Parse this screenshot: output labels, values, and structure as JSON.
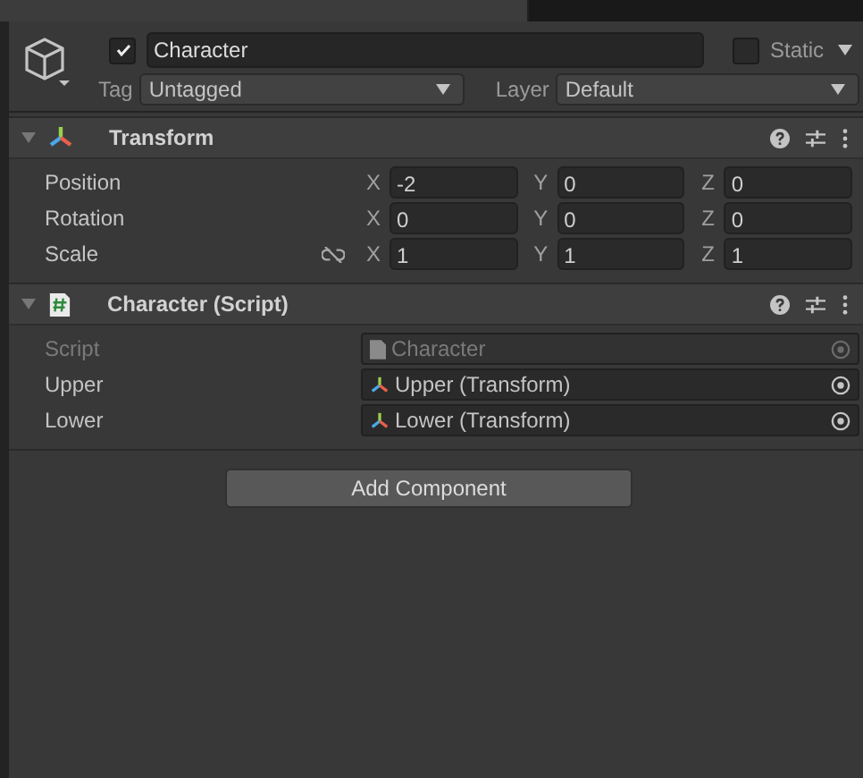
{
  "game_object": {
    "active": true,
    "name": "Character",
    "static": false,
    "static_label": "Static",
    "tag_label": "Tag",
    "tag": "Untagged",
    "layer_label": "Layer",
    "layer": "Default"
  },
  "components": [
    {
      "kind": "transform",
      "title": "Transform",
      "expanded": true,
      "rows": [
        {
          "kind": "vector",
          "label": "Position",
          "fields": [
            {
              "axis": "X",
              "value": "-2"
            },
            {
              "axis": "Y",
              "value": "0"
            },
            {
              "axis": "Z",
              "value": "0"
            }
          ]
        },
        {
          "kind": "vector",
          "label": "Rotation",
          "fields": [
            {
              "axis": "X",
              "value": "0"
            },
            {
              "axis": "Y",
              "value": "0"
            },
            {
              "axis": "Z",
              "value": "0"
            }
          ]
        },
        {
          "kind": "scale",
          "label": "Scale",
          "fields": [
            {
              "axis": "X",
              "value": "1"
            },
            {
              "axis": "Y",
              "value": "1"
            },
            {
              "axis": "Z",
              "value": "1"
            }
          ]
        }
      ]
    },
    {
      "kind": "script",
      "title": "Character (Script)",
      "expanded": true,
      "rows": [
        {
          "kind": "script",
          "label": "Script",
          "value": "Character",
          "disabled": true
        },
        {
          "kind": "object",
          "label": "Upper",
          "value": "Upper (Transform)",
          "disabled": false
        },
        {
          "kind": "object",
          "label": "Lower",
          "value": "Lower (Transform)",
          "disabled": false
        }
      ]
    }
  ],
  "add_button": "Add Component"
}
